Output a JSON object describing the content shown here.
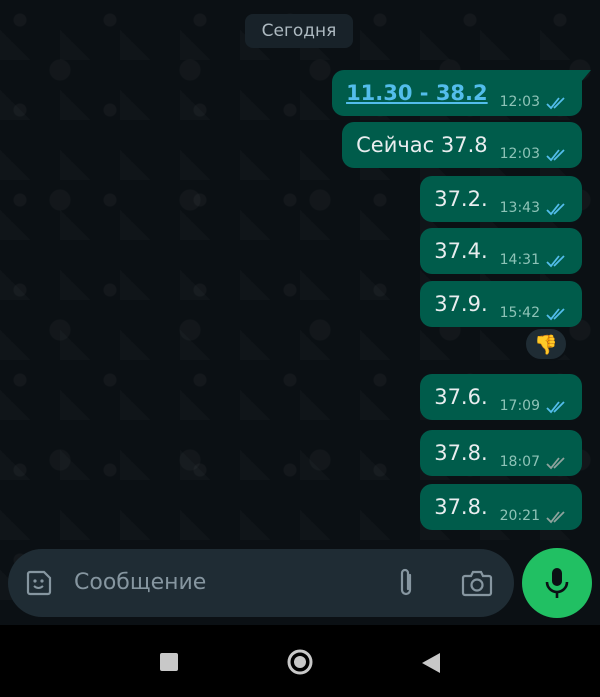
{
  "chat": {
    "date_chip": "Сегодня",
    "messages": [
      {
        "text": "11.30 - 38.2",
        "time": "12:03",
        "status": "read",
        "is_link": true
      },
      {
        "text": "Сейчас 37.8",
        "time": "12:03",
        "status": "read"
      },
      {
        "text": "37.2.",
        "time": "13:43",
        "status": "read"
      },
      {
        "text": "37.4.",
        "time": "14:31",
        "status": "read"
      },
      {
        "text": "37.9.",
        "time": "15:42",
        "status": "read",
        "reaction": "👎"
      },
      {
        "text": "37.6.",
        "time": "17:09",
        "status": "read"
      },
      {
        "text": "37.8.",
        "time": "18:07",
        "status": "delivered"
      },
      {
        "text": "37.8.",
        "time": "20:21",
        "status": "delivered"
      }
    ]
  },
  "composer": {
    "placeholder": "Сообщение",
    "icons": [
      "sticker-icon",
      "paperclip-icon",
      "camera-icon",
      "microphone-icon"
    ]
  },
  "colors": {
    "bubble": "#005c4b",
    "read_ticks": "#53bdeb",
    "delivered_ticks": "#8ea39d",
    "mic_button": "#21c063"
  },
  "navbar": {
    "icons": [
      "recents-square-icon",
      "home-circle-icon",
      "back-triangle-icon"
    ]
  }
}
